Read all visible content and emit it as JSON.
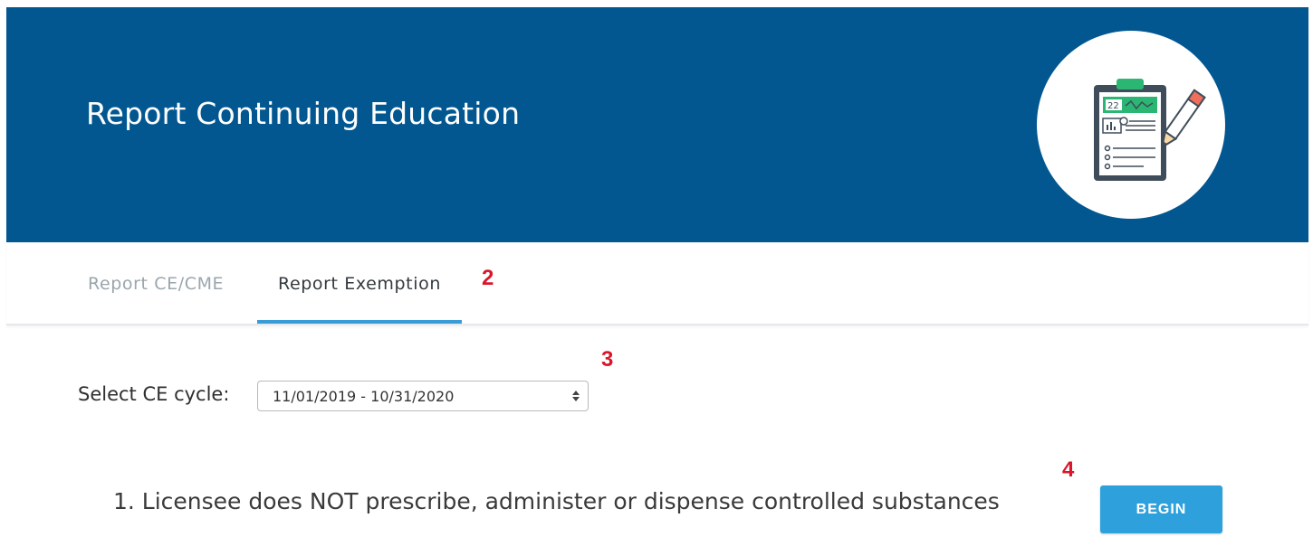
{
  "header": {
    "title": "Report Continuing Education",
    "illustration": "clipboard-checklist-icon",
    "illustration_text": "22",
    "background_color": "#025791"
  },
  "tabs": [
    {
      "label": "Report CE/CME",
      "active": false
    },
    {
      "label": "Report Exemption",
      "active": true
    }
  ],
  "annotations": [
    "2",
    "3",
    "4"
  ],
  "cycle": {
    "label": "Select CE cycle:",
    "selected": "11/01/2019 - 10/31/2020"
  },
  "exemptions": [
    {
      "text": "1. Licensee does NOT prescribe, administer or dispense controlled substances",
      "button": "BEGIN"
    }
  ],
  "colors": {
    "accent": "#2ea1dd",
    "tab_underline": "#3a9cd6",
    "annotation": "#d9162b"
  }
}
